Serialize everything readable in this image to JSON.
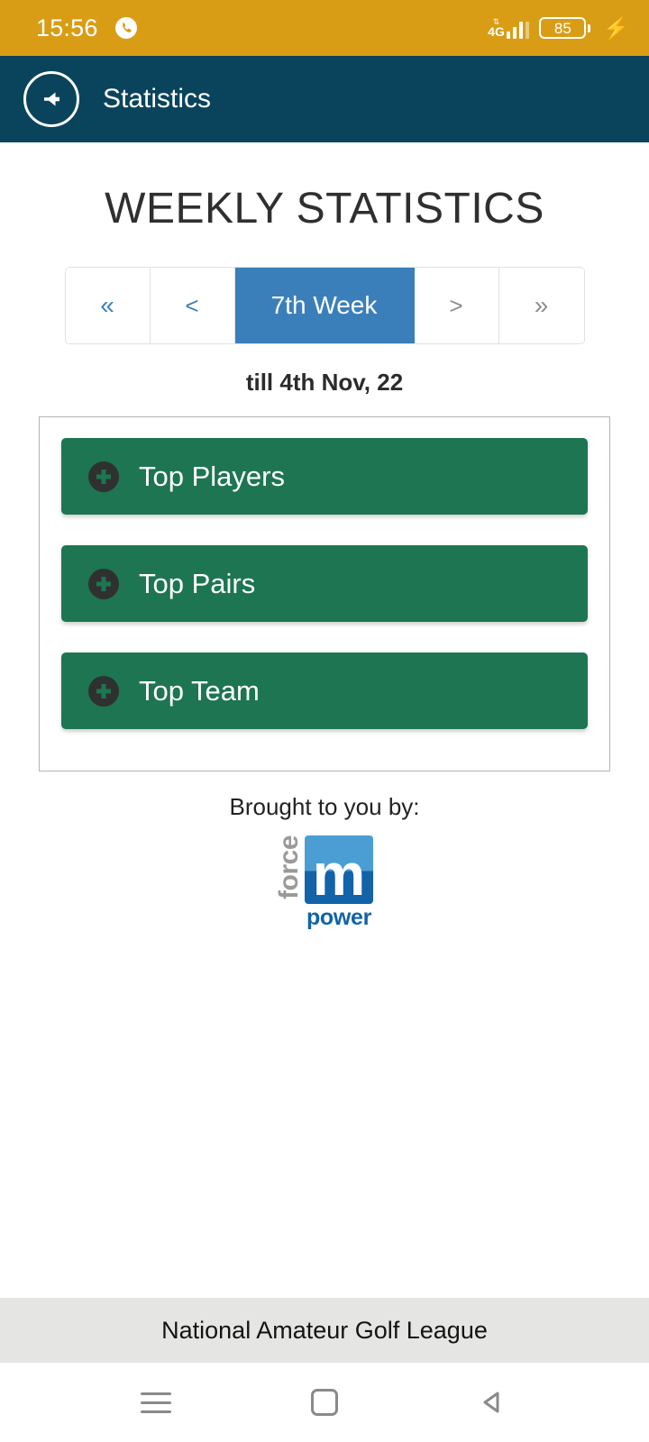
{
  "status_bar": {
    "time": "15:56",
    "phone_icon": "phone-call-icon",
    "network_updown": "⇅",
    "network_type": "4G",
    "signal_icon": "signal-bars-icon",
    "battery_level": "85",
    "charging_icon": "charging-bolt-icon",
    "background_color": "#d99d15"
  },
  "app_bar": {
    "back_icon": "back-arrow-icon",
    "title": "Statistics",
    "background_color": "#0a445c"
  },
  "main": {
    "page_title": "WEEKLY STATISTICS",
    "pager": {
      "first_label": "«",
      "prev_label": "<",
      "current_label": "7th Week",
      "next_label": ">",
      "last_label": "»",
      "active_color": "#3b7fba",
      "enabled_arrow_color": "#3b7fba",
      "disabled_arrow_color": "#8d8d8d"
    },
    "till_text": "till 4th Nov, 22",
    "accordion": {
      "items": [
        {
          "label": "Top Players",
          "icon": "plus-circle-icon"
        },
        {
          "label": "Top Pairs",
          "icon": "plus-circle-icon"
        },
        {
          "label": "Top Team",
          "icon": "plus-circle-icon"
        }
      ],
      "item_color": "#1d7552"
    },
    "sponsor": {
      "caption": "Brought to you by:",
      "logo_force": "force",
      "logo_mark": "m",
      "logo_power": "power",
      "logo_blue_light": "#4a9ed4",
      "logo_blue_dark": "#1263a8"
    }
  },
  "footer": {
    "text": "National Amateur Golf League",
    "background_color": "#e5e5e3"
  },
  "nav_bar": {
    "recents_icon": "menu-hamburger-icon",
    "home_icon": "home-square-icon",
    "back_icon": "back-triangle-icon"
  }
}
